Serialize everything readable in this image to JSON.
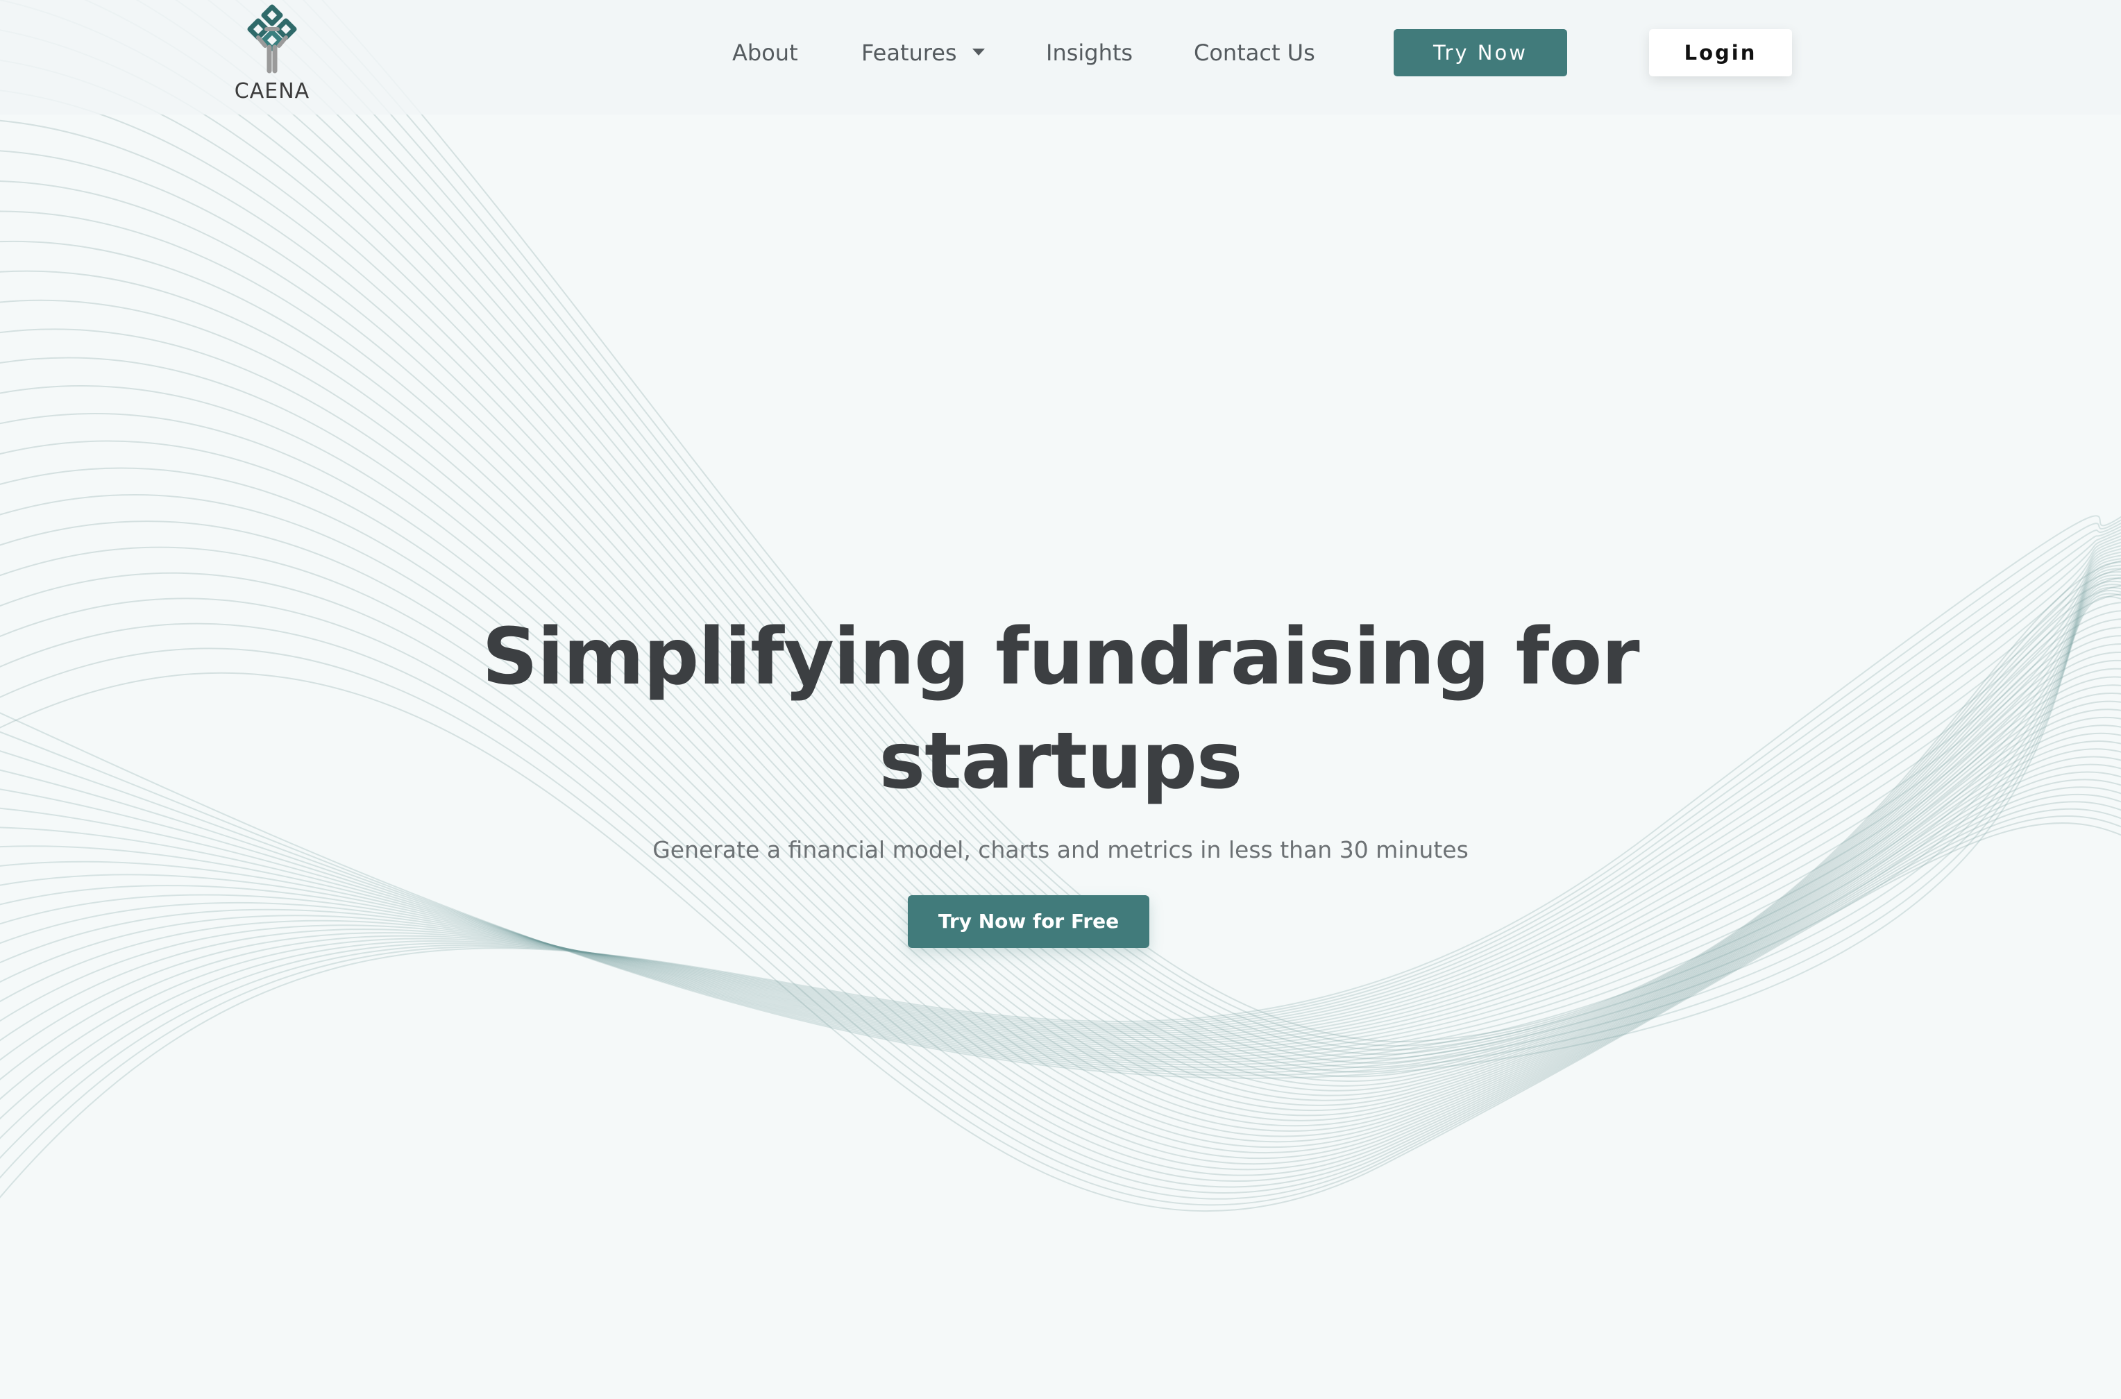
{
  "brand": {
    "name": "CAENA",
    "accent_color": "#417b7b",
    "logo_icon": "celtic-knot-tree-icon"
  },
  "nav": {
    "items": [
      {
        "label": "About"
      },
      {
        "label": "Features",
        "has_dropdown": true
      },
      {
        "label": "Insights"
      },
      {
        "label": "Contact Us"
      }
    ],
    "try_now_label": "Try Now",
    "login_label": "Login"
  },
  "hero": {
    "title_line1": "Simplifying fundraising for",
    "title_line2": "startups",
    "subtitle": "Generate a financial model, charts and metrics in less than 30 minutes",
    "cta_label": "Try Now for Free",
    "background": "teal-wave-lines"
  }
}
